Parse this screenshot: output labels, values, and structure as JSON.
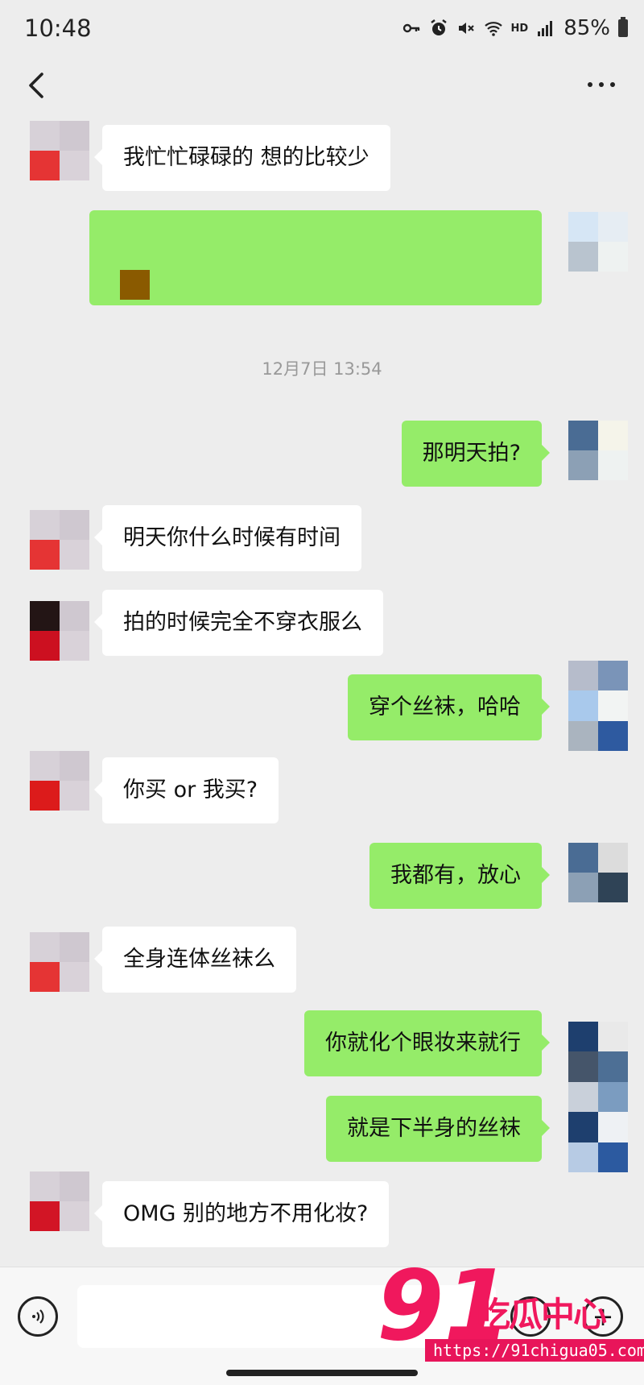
{
  "status_bar": {
    "time": "10:48",
    "hd": "HD",
    "battery": "85%"
  },
  "chat": {
    "timestamp": "12月7日 13:54",
    "messages": [
      {
        "side": "in",
        "text": "我忙忙碌碌的 想的比较少"
      },
      {
        "side": "out",
        "text": "那明天拍?"
      },
      {
        "side": "in",
        "text": "明天你什么时候有时间"
      },
      {
        "side": "in",
        "text": "拍的时候完全不穿衣服么"
      },
      {
        "side": "out",
        "text": "穿个丝袜，哈哈"
      },
      {
        "side": "in",
        "text": "你买 or 我买?"
      },
      {
        "side": "out",
        "text": "我都有，放心"
      },
      {
        "side": "in",
        "text": "全身连体丝袜么"
      },
      {
        "side": "out",
        "text": "你就化个眼妆来就行"
      },
      {
        "side": "out",
        "text": "就是下半身的丝袜"
      },
      {
        "side": "in",
        "text": "OMG 别的地方不用化妆?"
      }
    ]
  },
  "watermark": {
    "logo_number": "91",
    "logo_text": "吃瓜中心",
    "url": "https://91chigua05.com"
  },
  "colors": {
    "outgoing_bubble": "#95ec69",
    "incoming_bubble": "#ffffff",
    "background": "#ededed",
    "watermark": "#f0185d"
  }
}
